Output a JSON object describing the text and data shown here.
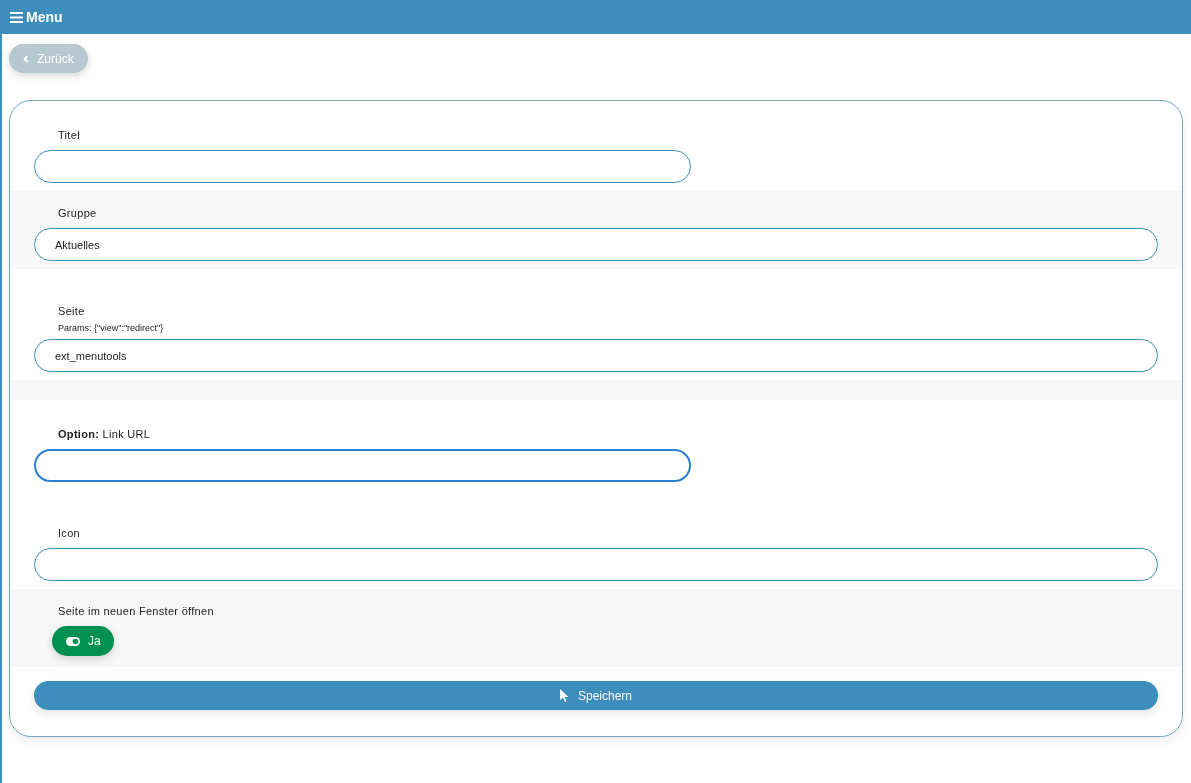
{
  "header": {
    "title": "Menu"
  },
  "back_button": {
    "label": "Zurück"
  },
  "sections": [
    {
      "fields": [
        {
          "label": "Titel",
          "kind": "short",
          "focused": false
        }
      ]
    },
    {
      "fields": [
        {
          "label": "Gruppe",
          "value": "Aktuelles",
          "kind": "full",
          "focused": false
        }
      ]
    },
    {
      "fields": [
        {
          "label": "Seite",
          "hint": "Params: {\"view\":\"redirect\"}",
          "value": "ext_menutools",
          "kind": "full",
          "focused": false
        }
      ]
    },
    {
      "fields": [
        {
          "label": "**Option:** Link URL",
          "kind": "short",
          "focused": true
        },
        {
          "label": "Icon",
          "kind": "full",
          "focused": false
        }
      ]
    },
    {
      "toggle": {
        "label": "Seite im neuen Fenster öffnen",
        "state_label": "Ja",
        "on": true
      }
    }
  ],
  "save_button": {
    "label": "Speichern"
  }
}
